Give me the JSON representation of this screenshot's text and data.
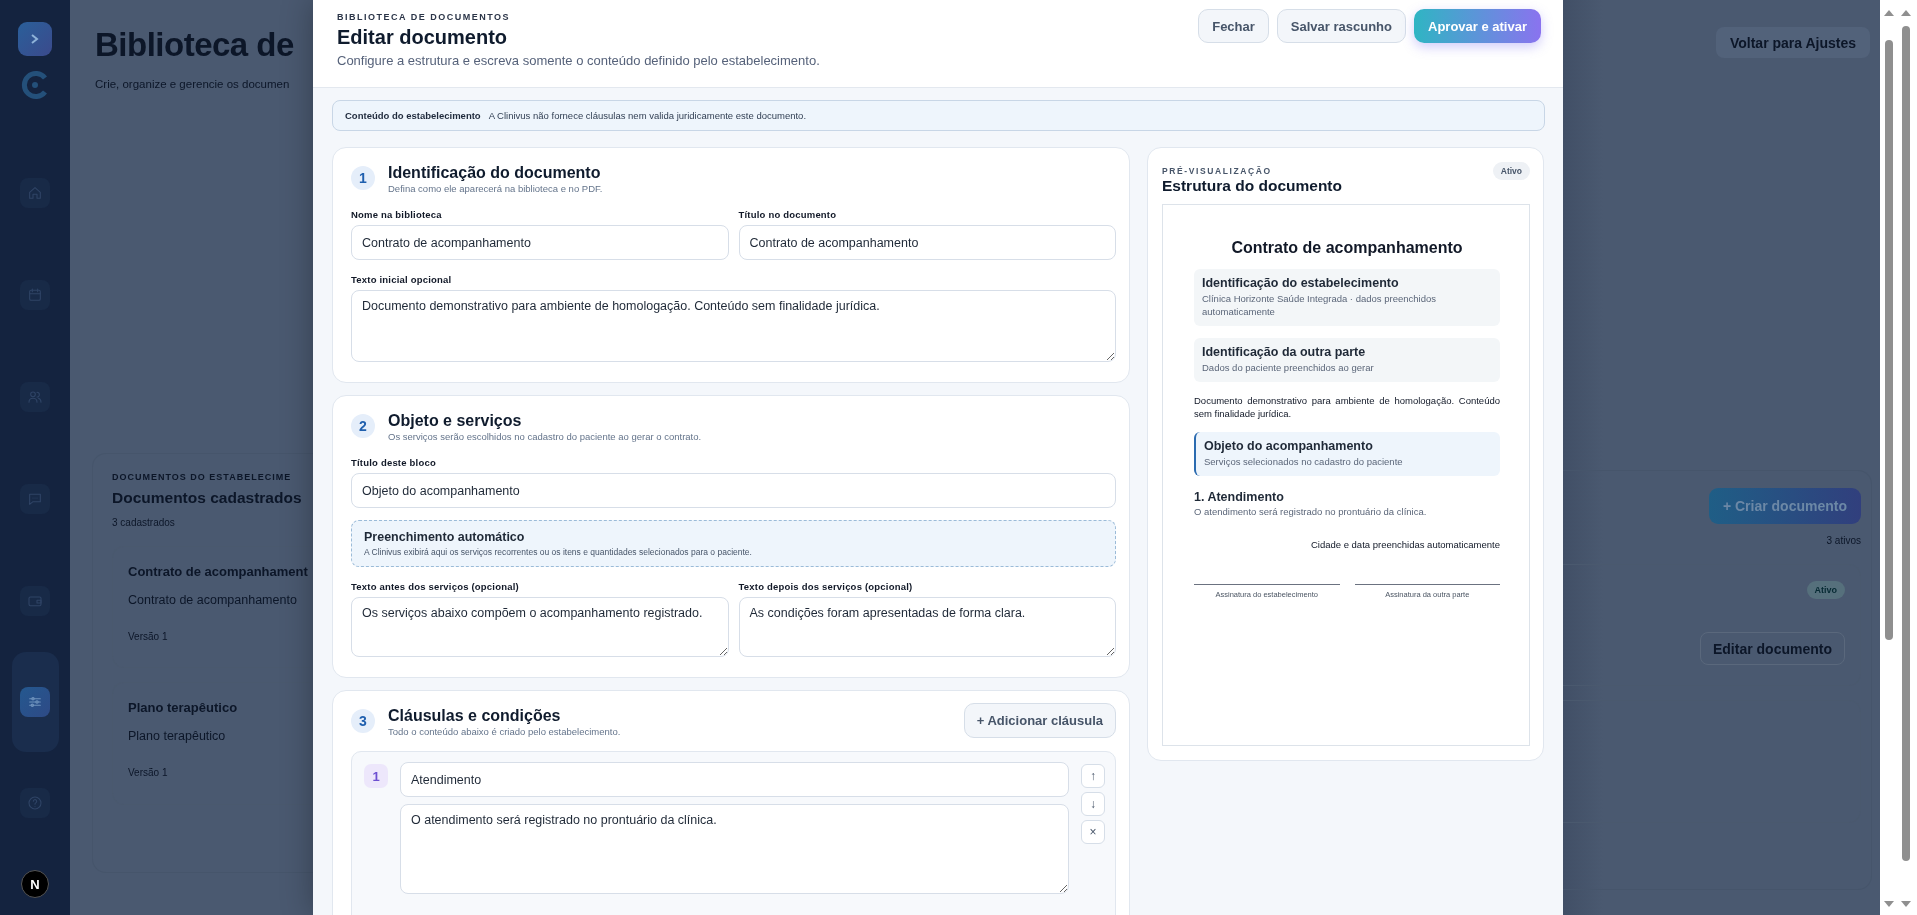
{
  "sidebar": {
    "items": [
      {
        "kind": "home",
        "selected": false
      },
      {
        "kind": "calendar",
        "selected": false
      },
      {
        "kind": "users",
        "selected": false
      },
      {
        "kind": "chat",
        "selected": false
      },
      {
        "kind": "wallet",
        "selected": false
      },
      {
        "kind": "settings",
        "selected": true
      },
      {
        "kind": "help",
        "selected": false
      }
    ],
    "dev_badge": "N"
  },
  "page": {
    "title": "Biblioteca de",
    "subtitle": "Crie, organize e gerencie os documen",
    "back_button": "Voltar para Ajustes"
  },
  "documents_panel": {
    "eyebrow": "DOCUMENTOS DO ESTABELECIME",
    "title": "Documentos cadastrados",
    "count": "3 cadastrados",
    "create_button": "+ Criar documento",
    "active_count": "3 ativos",
    "cards": [
      {
        "name": "Contrato de acompanhament",
        "document_title": "Contrato de acompanhamento",
        "version": "Versão 1",
        "status": "Ativo",
        "edit_button": "Editar documento"
      },
      {
        "name": "Plano terapêutico",
        "document_title": "Plano terapêutico",
        "version": "Versão 1"
      }
    ]
  },
  "modal": {
    "eyebrow": "BIBLIOTECA DE DOCUMENTOS",
    "title": "Editar documento",
    "subtitle": "Configure a estrutura e escreva somente o conteúdo definido pelo estabelecimento.",
    "buttons": [
      {
        "label": "Fechar",
        "kind": "secondary"
      },
      {
        "label": "Salvar rascunho",
        "kind": "secondary"
      },
      {
        "label": "Aprovar e ativar",
        "kind": "primary"
      }
    ]
  },
  "notice": {
    "title": "Conteúdo do estabelecimento",
    "text": "A Clinivus não fornece cláusulas nem valida juridicamente este documento."
  },
  "identification": {
    "number": "1",
    "title": "Identificação do documento",
    "description": "Defina como ele aparecerá na biblioteca e no PDF.",
    "fields": [
      {
        "label": "Nome na biblioteca",
        "value": "Contrato de acompanhamento"
      },
      {
        "label": "Título no documento",
        "value": "Contrato de acompanhamento"
      }
    ],
    "intro": {
      "label": "Texto inicial opcional",
      "value": "Documento demonstrativo para ambiente de homologação. Conteúdo sem finalidade jurídica."
    }
  },
  "object": {
    "number": "2",
    "title": "Objeto e serviços",
    "description": "Os serviços serão escolhidos no cadastro do paciente ao gerar o contrato.",
    "block_title": {
      "label": "Título deste bloco",
      "value": "Objeto do acompanhamento"
    },
    "auto_fill": {
      "title": "Preenchimento automático",
      "text": "A Clinivus exibirá aqui os serviços recorrentes ou os itens e quantidades selecionados para o paciente."
    },
    "texts": [
      {
        "label": "Texto antes dos serviços (opcional)",
        "value": "Os serviços abaixo compõem o acompanhamento registrado."
      },
      {
        "label": "Texto depois dos serviços (opcional)",
        "value": "As condições foram apresentadas de forma clara."
      }
    ]
  },
  "clauses": {
    "number": "3",
    "title": "Cláusulas e condições",
    "description": "Todo o conteúdo abaixo é criado pelo estabelecimento.",
    "add_button": "+ Adicionar cláusula",
    "items": [
      {
        "number": "1",
        "title": "Atendimento",
        "text": "O atendimento será registrado no prontuário da clínica.",
        "actions": [
          "↑",
          "↓",
          "×"
        ]
      }
    ]
  },
  "preview": {
    "eyebrow": "PRÉ-VISUALIZAÇÃO",
    "title": "Estrutura do documento",
    "status": "Ativo",
    "document": {
      "title": "Contrato de acompanhamento",
      "blocks": [
        {
          "kind": "info",
          "title": "Identificação do estabelecimento",
          "text": "Clínica Horizonte Saúde Integrada · dados preenchidos automaticamente"
        },
        {
          "kind": "info",
          "title": "Identificação da outra parte",
          "text": "Dados do paciente preenchidos ao gerar"
        },
        {
          "kind": "paragraph",
          "text": "Documento demonstrativo para ambiente de homologação. Conteúdo sem finalidade jurídica."
        },
        {
          "kind": "highlight",
          "title": "Objeto do acompanhamento",
          "text": "Serviços selecionados no cadastro do paciente"
        },
        {
          "kind": "clause",
          "title": "1. Atendimento",
          "text": "O atendimento será registrado no prontuário da clínica."
        }
      ],
      "place_date": "Cidade e data preenchidas automaticamente",
      "signatures": [
        "Assinatura do estabelecimento",
        "Assinatura da outra parte"
      ]
    }
  }
}
